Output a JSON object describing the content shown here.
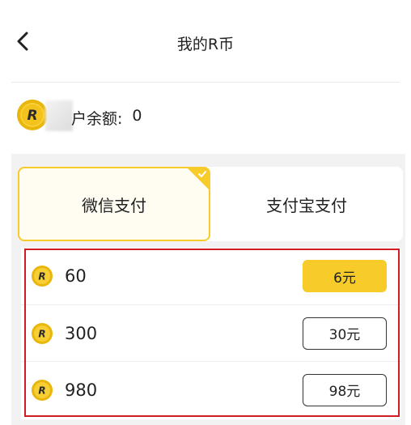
{
  "header": {
    "back_icon": "chevron-left-icon",
    "title": "我的R币"
  },
  "balance": {
    "coin_icon": "r-coin-icon",
    "label_visible": "户余额:",
    "value": "0"
  },
  "payment_methods": [
    {
      "label": "微信支付",
      "selected": true
    },
    {
      "label": "支付宝支付",
      "selected": false
    }
  ],
  "products": [
    {
      "amount": "60",
      "price": "6元",
      "selected": true
    },
    {
      "amount": "300",
      "price": "30元",
      "selected": false
    },
    {
      "amount": "980",
      "price": "98元",
      "selected": false
    }
  ],
  "colors": {
    "accent": "#f7cb2a",
    "highlight_outline": "#cf1b22",
    "background_gray": "#f2f2f2"
  }
}
